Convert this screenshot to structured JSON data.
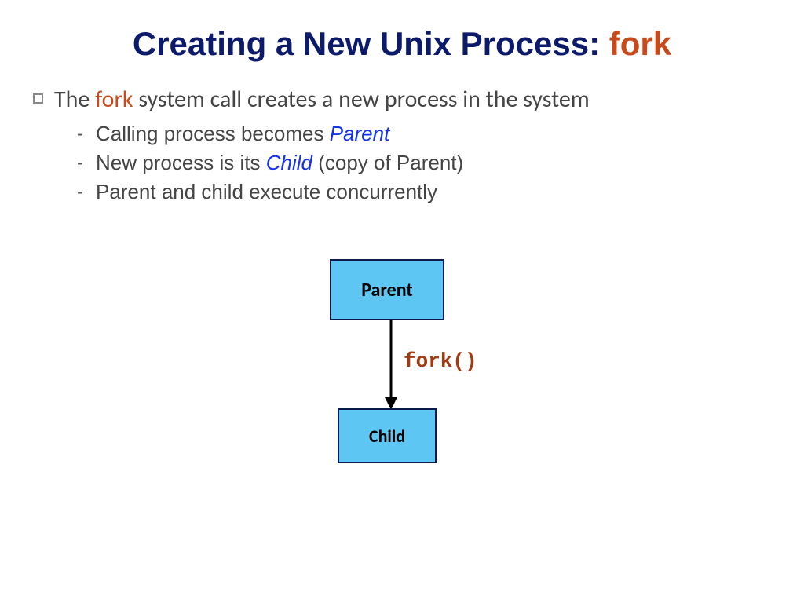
{
  "title": {
    "main": "Creating a New Unix Process: ",
    "accent": "fork"
  },
  "bullet": {
    "prefix": "The ",
    "accent": "fork",
    "suffix": " system call creates a new process in the system"
  },
  "subs": [
    {
      "prefix": "Calling process becomes ",
      "kw": "Parent",
      "suffix": ""
    },
    {
      "prefix": "New process is its ",
      "kw": "Child",
      "suffix": " (copy of Parent)"
    },
    {
      "prefix": "Parent and child execute concurrently",
      "kw": "",
      "suffix": ""
    }
  ],
  "diagram": {
    "parent": "Parent",
    "child": "Child",
    "call": "fork()"
  }
}
